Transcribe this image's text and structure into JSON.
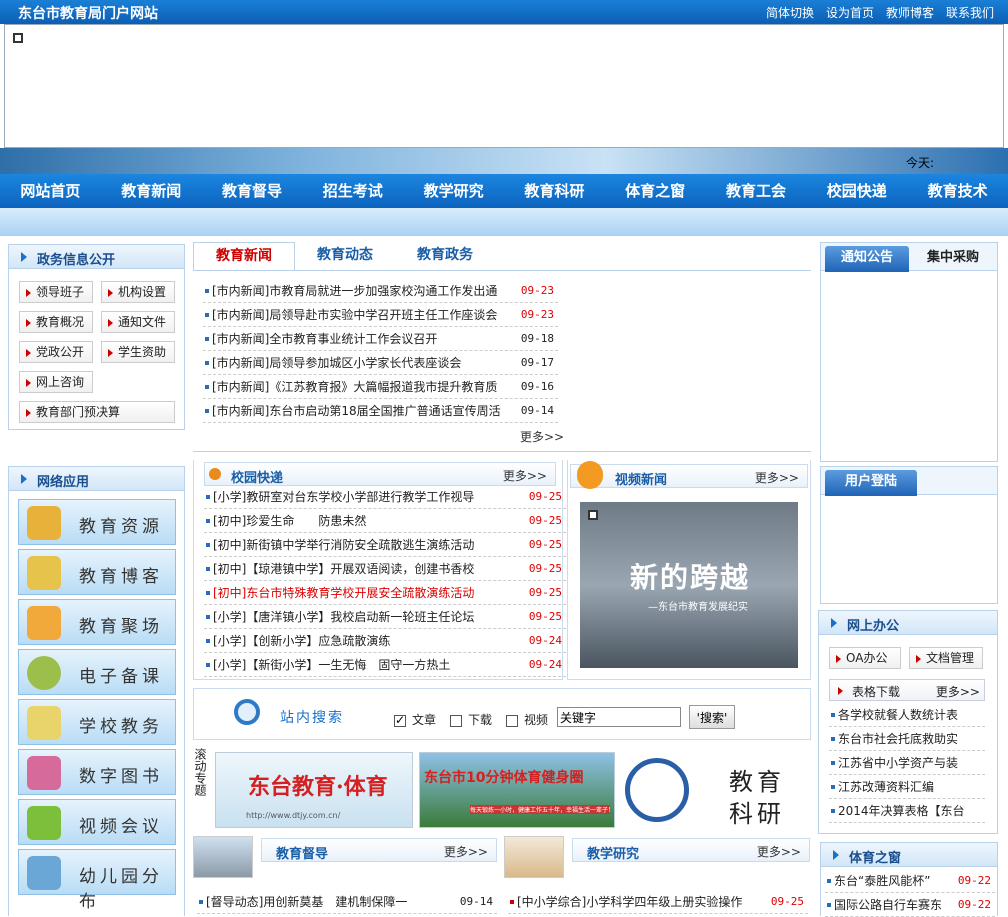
{
  "header": {
    "site_title": "东台市教育局门户网站",
    "links": [
      "简体切换",
      "设为首页",
      "教师博客",
      "联系我们"
    ]
  },
  "date_label": "今天:",
  "nav": [
    "网站首页",
    "教育新闻",
    "教育督导",
    "招生考试",
    "教学研究",
    "教育科研",
    "体育之窗",
    "教育工会",
    "校园快递",
    "教育技术"
  ],
  "gov": {
    "title": "政务信息公开",
    "buttons": [
      "领导班子",
      "机构设置",
      "教育概况",
      "通知文件",
      "党政公开",
      "学生资助",
      "网上咨询",
      "教育部门预决算"
    ]
  },
  "apps": {
    "title": "网络应用",
    "items": [
      "教育资源",
      "教育博客",
      "教育聚场",
      "电子备课",
      "学校教务",
      "数字图书",
      "视频会议",
      "幼儿园分布"
    ]
  },
  "news": {
    "tabs": [
      "教育新闻",
      "教育动态",
      "教育政务"
    ],
    "rows": [
      {
        "text": "[市内新闻]市教育局就进一步加强家校沟通工作发出通",
        "date": "09-23",
        "hot": true
      },
      {
        "text": "[市内新闻]局领导赴市实验中学召开班主任工作座谈会",
        "date": "09-23",
        "hot": true
      },
      {
        "text": "[市内新闻]全市教育事业统计工作会议召开",
        "date": "09-18",
        "hot": false
      },
      {
        "text": "[市内新闻]局领导参加城区小学家长代表座谈会",
        "date": "09-17",
        "hot": false
      },
      {
        "text": "[市内新闻]《江苏教育报》大篇幅报道我市提升教育质",
        "date": "09-16",
        "hot": false
      },
      {
        "text": "[市内新闻]东台市启动第18届全国推广普通话宣传周活",
        "date": "09-14",
        "hot": false
      }
    ],
    "more": "更多>>"
  },
  "campus": {
    "title": "校园快递",
    "more": "更多>>",
    "rows": [
      {
        "text": "[小学]教研室对台东学校小学部进行教学工作视导",
        "date": "09-25",
        "red_text": false
      },
      {
        "text": "[初中]珍爱生命　　防患未然",
        "date": "09-25",
        "red_text": false
      },
      {
        "text": "[初中]新街镇中学举行消防安全疏散逃生演练活动",
        "date": "09-25",
        "red_text": false
      },
      {
        "text": "[初中]【琼港镇中学】开展双语阅读，创建书香校",
        "date": "09-25",
        "red_text": false
      },
      {
        "text": "[初中]东台市特殊教育学校开展安全疏散演练活动",
        "date": "09-25",
        "red_text": true
      },
      {
        "text": "[小学]【唐洋镇小学】我校启动新一轮班主任论坛",
        "date": "09-25",
        "red_text": false
      },
      {
        "text": "[小学]【创新小学】应急疏散演练",
        "date": "09-24",
        "red_text": false
      },
      {
        "text": "[小学]【新街小学】一生无悔　固守一方热土",
        "date": "09-24",
        "red_text": false
      }
    ]
  },
  "video": {
    "title": "视频新闻",
    "more": "更多>>",
    "caption": "新的跨越",
    "sub": "—东台市教育发展纪实"
  },
  "search": {
    "title": "站内搜索",
    "options": [
      {
        "label": "文章",
        "checked": true
      },
      {
        "label": "下载",
        "checked": false
      },
      {
        "label": "视频",
        "checked": false
      }
    ],
    "placeholder": "关键字",
    "button": "搜索"
  },
  "special": {
    "label": "滚动专题",
    "banner1": "东台教育·体育",
    "banner1_url": "http://www.dtjy.com.cn/",
    "banner2": "东台市10分钟体育健身圈",
    "banner2_sub": "每天锻炼一小时，健康工作五十年，幸福生活一辈子！",
    "banner3a": "教育",
    "banner3b": "科研"
  },
  "dudao": {
    "title": "教育督导",
    "more": "更多>>",
    "rows": [
      {
        "text": "[督导动态]用创新莫基　建机制保障一",
        "date": "09-14"
      }
    ]
  },
  "jiaoyan": {
    "title": "教学研究",
    "more": "更多>>",
    "rows": [
      {
        "text": "[中小学综合]小学科学四年级上册实验操作",
        "date": "09-25"
      }
    ]
  },
  "notice": {
    "tabs": [
      "通知公告",
      "集中采购"
    ]
  },
  "login": {
    "title": "用户登陆"
  },
  "office": {
    "title": "网上办公",
    "buttons": [
      "OA办公",
      "文档管理"
    ],
    "sub": "表格下载",
    "more": "更多>>",
    "rows": [
      "各学校就餐人数统计表",
      "东台市社会托底救助实",
      "江苏省中小学资产与装",
      "江苏改薄资料汇编",
      "2014年决算表格【东台"
    ]
  },
  "sports": {
    "title": "体育之窗",
    "rows": [
      {
        "text": "东台“泰胜风能杯”",
        "date": "09-22"
      },
      {
        "text": "国际公路自行车赛东",
        "date": "09-22"
      }
    ]
  }
}
